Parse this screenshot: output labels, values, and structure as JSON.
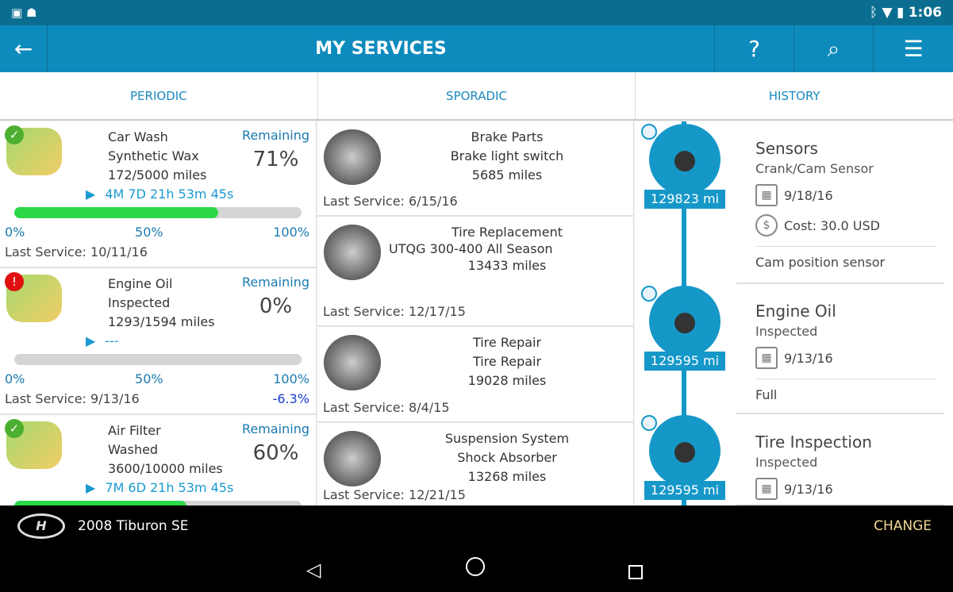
{
  "status_bar": {
    "time": "1:06",
    "left_icons": [
      "image-icon",
      "android-icon"
    ],
    "right_icons": [
      "bluetooth-icon",
      "wifi-icon",
      "battery-icon"
    ]
  },
  "app_bar": {
    "title": "MY SERVICES",
    "back": "←",
    "help": "?",
    "search": "⌕",
    "filter": "☰"
  },
  "tabs": [
    {
      "label": "PERIODIC"
    },
    {
      "label": "SPORADIC"
    },
    {
      "label": "HISTORY"
    }
  ],
  "periodic": [
    {
      "name": "Car Wash",
      "detail": "Synthetic Wax",
      "miles": "172/5000 miles",
      "timer": "4M 7D 21h 53m 45s",
      "remaining_label": "Remaining",
      "remaining": "71%",
      "progress": 71,
      "scale": [
        "0%",
        "50%",
        "100%"
      ],
      "last_service": "Last Service: 10/11/16",
      "status": "ok"
    },
    {
      "name": "Engine Oil",
      "detail": "Inspected",
      "miles": "1293/1594 miles",
      "timer": "---",
      "remaining_label": "Remaining",
      "remaining": "0%",
      "progress": 0,
      "scale": [
        "0%",
        "50%",
        "100%"
      ],
      "last_service": "Last Service: 9/13/16",
      "overdue": "-6.3%",
      "status": "alert"
    },
    {
      "name": "Air Filter",
      "detail": "Washed",
      "miles": "3600/10000 miles",
      "timer": "7M 6D 21h 53m 45s",
      "remaining_label": "Remaining",
      "remaining": "60%",
      "progress": 60,
      "scale": [
        "0%",
        "50%",
        "100%"
      ],
      "last_service": "",
      "status": "ok"
    }
  ],
  "sporadic": [
    {
      "name": "Brake Parts",
      "detail": "Brake light switch",
      "miles": "5685 miles",
      "last_service": "Last Service: 6/15/16"
    },
    {
      "name": "Tire Replacement",
      "detail": "UTQG 300-400 All Season",
      "miles": "13433 miles",
      "last_service": "Last Service: 12/17/15"
    },
    {
      "name": "Tire Repair",
      "detail": "Tire Repair",
      "miles": "19028 miles",
      "last_service": "Last Service: 8/4/15"
    },
    {
      "name": "Suspension System",
      "detail": "Shock Absorber",
      "miles": "13268 miles",
      "last_service": "Last Service: 12/21/15"
    }
  ],
  "history": [
    {
      "mileage": "129823 mi",
      "title": "Sensors",
      "detail": "Crank/Cam Sensor",
      "date": "9/18/16",
      "cost": "Cost: 30.0 USD",
      "note": "Cam position sensor"
    },
    {
      "mileage": "129595 mi",
      "title": "Engine Oil",
      "detail": "Inspected",
      "date": "9/13/16",
      "note": "Full"
    },
    {
      "mileage": "129595 mi",
      "title": "Tire Inspection",
      "detail": "Inspected",
      "date": "9/13/16"
    }
  ],
  "vehicle": {
    "name": "2008 Tiburon SE",
    "change": "CHANGE"
  },
  "colors": {
    "accent": "#0e8bbd",
    "progress": "#2bd84a",
    "change": "#f0d890"
  }
}
